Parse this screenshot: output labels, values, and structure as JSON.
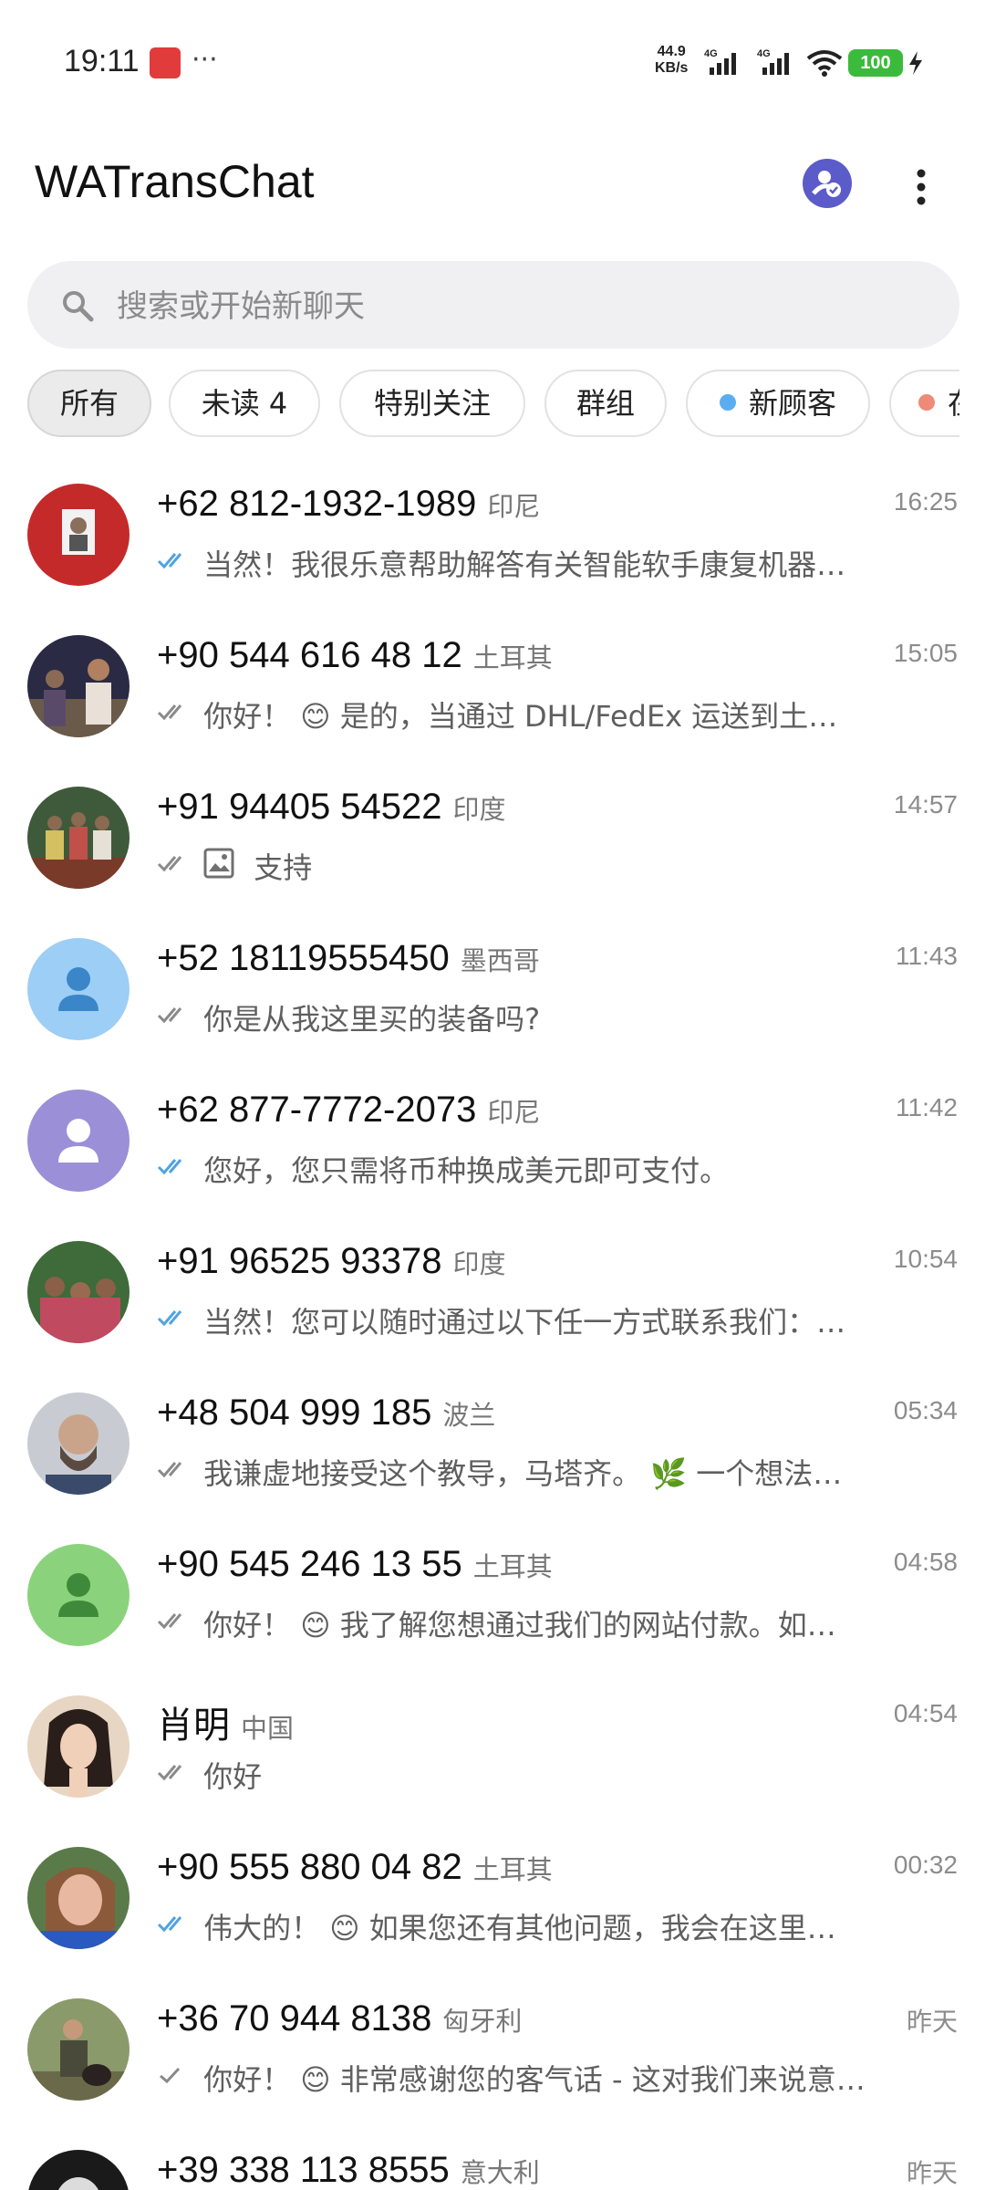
{
  "status_bar": {
    "time": "19:11",
    "more": "···",
    "speed_value": "44.9",
    "speed_unit": "KB/s",
    "net1": "4G",
    "net2": "4G",
    "battery": "100"
  },
  "app_bar": {
    "title": "WATransChat"
  },
  "search": {
    "placeholder": "搜索或开始新聊天"
  },
  "filters": [
    {
      "label": "所有",
      "active": true
    },
    {
      "label": "未读 4",
      "active": false
    },
    {
      "label": "特别关注",
      "active": false
    },
    {
      "label": "群组",
      "active": false
    },
    {
      "label": "新顾客",
      "active": false,
      "dot_color": "#5aaef0"
    },
    {
      "label": "在",
      "active": false,
      "dot_color": "#ee8a78"
    }
  ],
  "chats": [
    {
      "name": "+62 812-1932-1989",
      "country": "印尼",
      "time": "16:25",
      "tick": "double-blue",
      "preview": "当然！我很乐意帮助解答有关智能软手康复机器…"
    },
    {
      "name": "+90 544 616 48 12",
      "country": "土耳其",
      "time": "15:05",
      "tick": "double-gray",
      "preview": "你好！ 😊 是的，当通过 DHL/FedEx 运送到土…"
    },
    {
      "name": "+91 94405 54522",
      "country": "印度",
      "time": "14:57",
      "tick": "double-gray",
      "preview": "支持",
      "has_image": true
    },
    {
      "name": "+52 18119555450",
      "country": "墨西哥",
      "time": "11:43",
      "tick": "double-gray",
      "preview": "你是从我这里买的装备吗?"
    },
    {
      "name": "+62 877-7772-2073",
      "country": "印尼",
      "time": "11:42",
      "tick": "double-blue",
      "preview": "您好，您只需将币种换成美元即可支付。"
    },
    {
      "name": "+91 96525 93378",
      "country": "印度",
      "time": "10:54",
      "tick": "double-blue",
      "preview": "当然！您可以随时通过以下任一方式联系我们：…"
    },
    {
      "name": "+48 504 999 185",
      "country": "波兰",
      "time": "05:34",
      "tick": "double-gray",
      "preview": "我谦虚地接受这个教导，马塔齐。 🌿 一个想法…"
    },
    {
      "name": "+90 545 246 13 55",
      "country": "土耳其",
      "time": "04:58",
      "tick": "double-gray",
      "preview": "你好！ 😊 我了解您想通过我们的网站付款。如…"
    },
    {
      "name": "肖明",
      "country": "中国",
      "time": "04:54",
      "tick": "double-gray",
      "preview": "你好"
    },
    {
      "name": "+90 555 880 04 82",
      "country": "土耳其",
      "time": "00:32",
      "tick": "double-blue",
      "preview": "伟大的！ 😊 如果您还有其他问题，我会在这里…"
    },
    {
      "name": "+36 70 944 8138",
      "country": "匈牙利",
      "time": "昨天",
      "tick": "single-gray",
      "preview": "你好！ 😊 非常感谢您的客气话 - 这对我们来说意…"
    },
    {
      "name": "+39 338 113 8555",
      "country": "意大利",
      "time": "昨天",
      "tick": "double-gray",
      "preview": ""
    }
  ],
  "colors": {
    "accent_blue": "#4fa3e0",
    "tick_gray": "#8a8a8a",
    "avatar_light_blue": "#9dcef5",
    "avatar_purple": "#9b8fd8",
    "avatar_green": "#8ad37c",
    "profile_btn": "#5b5bc9",
    "battery": "#3bbb3b"
  }
}
